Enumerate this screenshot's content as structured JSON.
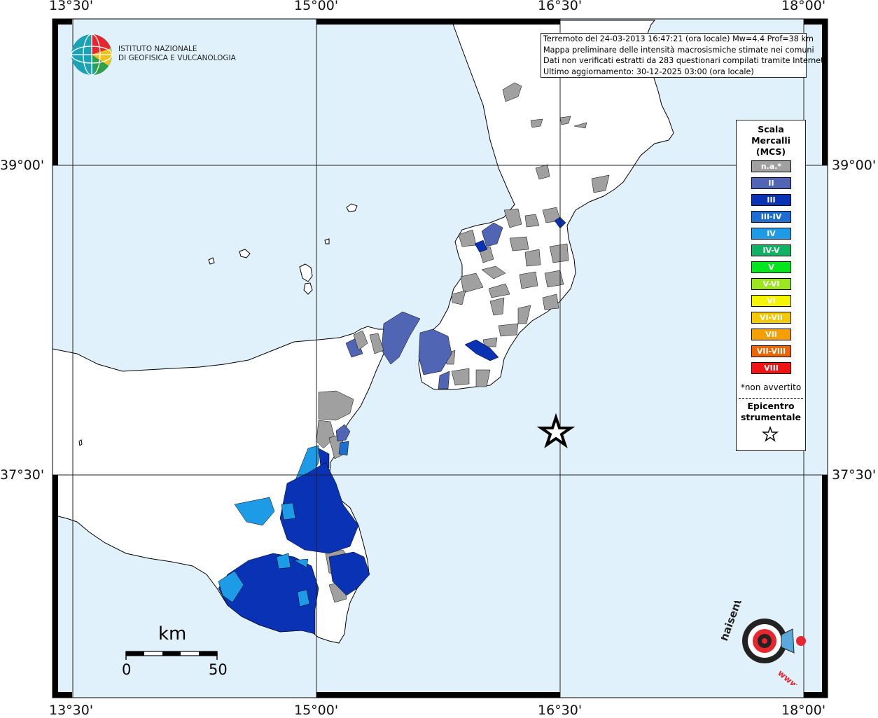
{
  "map": {
    "lon_labels": [
      "13°30'",
      "15°00'",
      "16°30'",
      "18°00'"
    ],
    "lat_labels": [
      "39°00'",
      "37°30'"
    ]
  },
  "institute": {
    "line1": "ISTITUTO NAZIONALE",
    "line2": "DI GEOFISICA E VULCANOLOGIA"
  },
  "info": {
    "line1": "Terremoto del 24-03-2013 16:47:21 (ora locale) Mw=4.4 Prof=38 km",
    "line2": "Mappa preliminare delle intensità macrosismiche stimate nei comuni",
    "line3": "Dati non verificati estratti da 283 questionari compilati tramite Internet.",
    "line4": "Ultimo aggiornamento: 30-12-2025 03:00 (ora locale)"
  },
  "legend": {
    "title": "Scala Mercalli (MCS)",
    "title_lines": [
      "Scala",
      "Mercalli",
      "(MCS)"
    ],
    "classes": [
      {
        "label": "n.a.*",
        "color": "#a0a0a0"
      },
      {
        "label": "II",
        "color": "#5065b4"
      },
      {
        "label": "III",
        "color": "#0a32b4"
      },
      {
        "label": "III-IV",
        "color": "#1e6ed2"
      },
      {
        "label": "IV",
        "color": "#1e9be6"
      },
      {
        "label": "IV-V",
        "color": "#10b264"
      },
      {
        "label": "V",
        "color": "#00e61e"
      },
      {
        "label": "V-VI",
        "color": "#9be61e"
      },
      {
        "label": "VI",
        "color": "#f5f500"
      },
      {
        "label": "VI-VII",
        "color": "#f5c800"
      },
      {
        "label": "VII",
        "color": "#f5a000"
      },
      {
        "label": "VII-VIII",
        "color": "#f06400"
      },
      {
        "label": "VIII",
        "color": "#f01414"
      }
    ],
    "note": "*non avvertito",
    "epicenter_lines": [
      "Epicentro",
      "strumentale"
    ]
  },
  "scale_bar": {
    "unit": "km",
    "min_label": "0",
    "max_label": "50"
  },
  "colors": {
    "sea": "#e1f1fb",
    "land": "#ffffff",
    "border": "#000000"
  },
  "site": {
    "logo_text": "haisentitoilterremoto.it",
    "prefix": "www."
  }
}
